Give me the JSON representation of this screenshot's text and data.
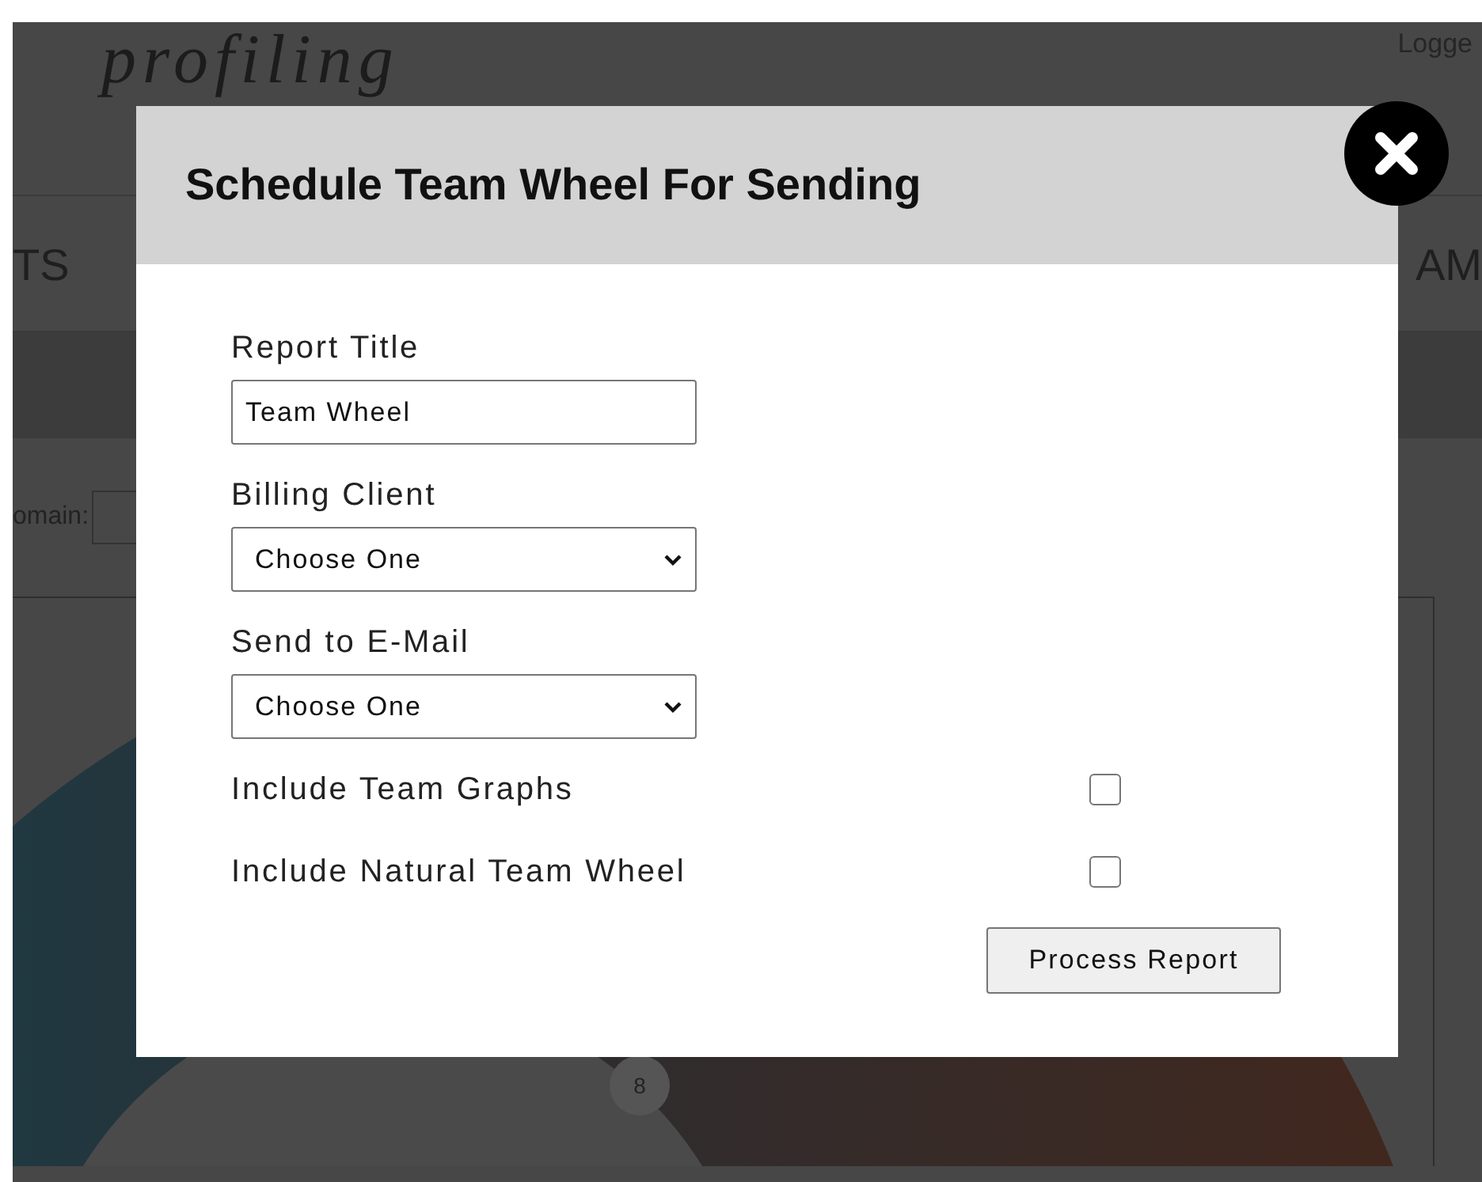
{
  "page": {
    "logo": "profiling",
    "login_text": "Logge",
    "nav_left": "TS",
    "nav_right": "AM",
    "domain_label": "omain:",
    "wheel_badge": "8"
  },
  "dialog": {
    "title": "Schedule Team Wheel For Sending",
    "fields": [
      {
        "kind": "text",
        "label": "Report Title",
        "value": "Team Wheel"
      },
      {
        "kind": "select",
        "label": "Billing Client",
        "value": "Choose One"
      },
      {
        "kind": "select",
        "label": "Send to E-Mail",
        "value": "Choose One"
      }
    ],
    "options": [
      {
        "label": "Include Team Graphs",
        "checked": false
      },
      {
        "label": "Include Natural Team Wheel",
        "checked": false
      }
    ],
    "button": "Process Report"
  }
}
